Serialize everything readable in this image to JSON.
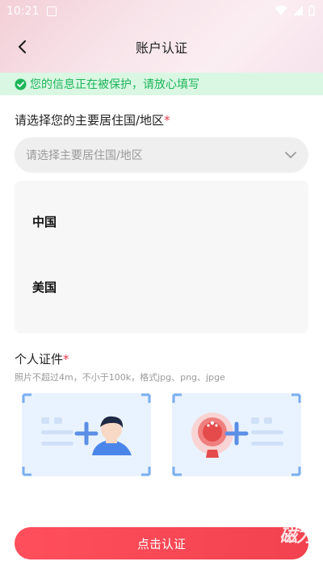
{
  "status_bar": {
    "time": "10:21"
  },
  "header": {
    "title": "账户认证"
  },
  "notice": {
    "text": "您的信息正在被保护，请放心填写"
  },
  "region": {
    "label": "请选择您的主要居住国/地区",
    "required_mark": "*",
    "placeholder": "请选择主要居住国/地区",
    "options": [
      "中国",
      "美国"
    ]
  },
  "id_section": {
    "label": "个人证件",
    "required_mark": "*",
    "hint": "照片不超过4m，不小于100k，格式jpg、png、jpge"
  },
  "submit": {
    "label": "点击认证"
  },
  "watermark": {
    "text": "磁力"
  },
  "colors": {
    "accent": "#f2424f",
    "notice_green": "#1eb55a",
    "notice_bg": "#d9f7e3"
  }
}
